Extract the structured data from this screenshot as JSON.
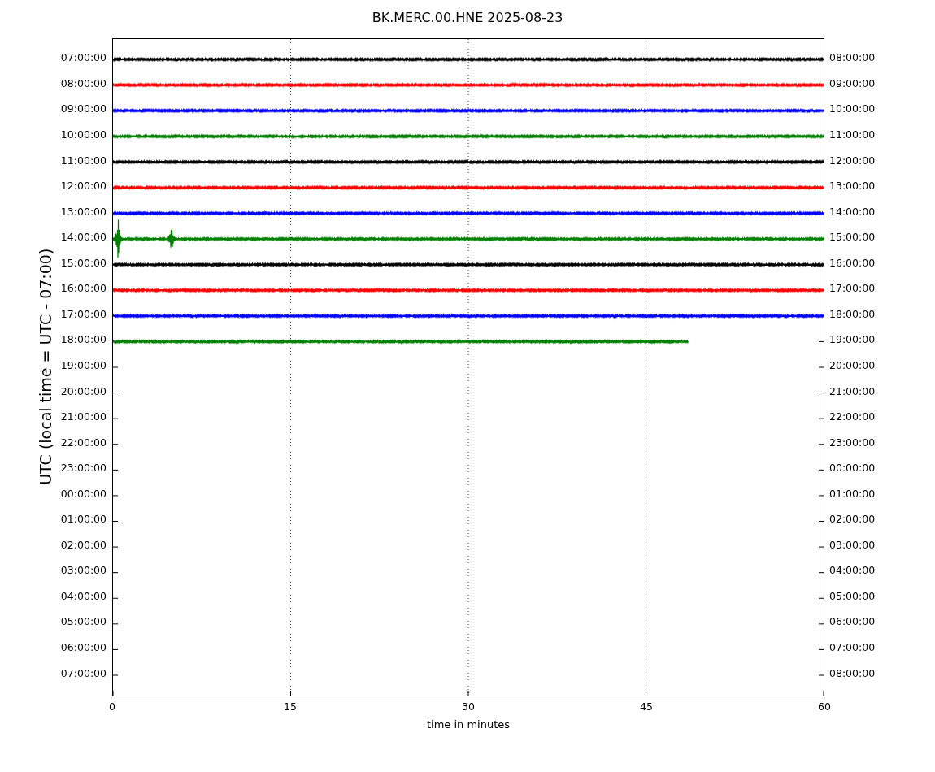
{
  "title": "BK.MERC.00.HNE 2025-08-23",
  "y_axis_label": "UTC (local time = UTC - 07:00)",
  "x_axis_label": "time in minutes",
  "x_ticks": [
    "0",
    "15",
    "30",
    "45",
    "60"
  ],
  "rows": [
    {
      "left": "07:00:00",
      "right": "08:00:00"
    },
    {
      "left": "08:00:00",
      "right": "09:00:00"
    },
    {
      "left": "09:00:00",
      "right": "10:00:00"
    },
    {
      "left": "10:00:00",
      "right": "11:00:00"
    },
    {
      "left": "11:00:00",
      "right": "12:00:00"
    },
    {
      "left": "12:00:00",
      "right": "13:00:00"
    },
    {
      "left": "13:00:00",
      "right": "14:00:00"
    },
    {
      "left": "14:00:00",
      "right": "15:00:00"
    },
    {
      "left": "15:00:00",
      "right": "16:00:00"
    },
    {
      "left": "16:00:00",
      "right": "17:00:00"
    },
    {
      "left": "17:00:00",
      "right": "18:00:00"
    },
    {
      "left": "18:00:00",
      "right": "19:00:00"
    },
    {
      "left": "19:00:00",
      "right": "20:00:00"
    },
    {
      "left": "20:00:00",
      "right": "21:00:00"
    },
    {
      "left": "21:00:00",
      "right": "22:00:00"
    },
    {
      "left": "22:00:00",
      "right": "23:00:00"
    },
    {
      "left": "23:00:00",
      "right": "00:00:00"
    },
    {
      "left": "00:00:00",
      "right": "01:00:00"
    },
    {
      "left": "01:00:00",
      "right": "02:00:00"
    },
    {
      "left": "02:00:00",
      "right": "03:00:00"
    },
    {
      "left": "03:00:00",
      "right": "04:00:00"
    },
    {
      "left": "04:00:00",
      "right": "05:00:00"
    },
    {
      "left": "05:00:00",
      "right": "06:00:00"
    },
    {
      "left": "06:00:00",
      "right": "07:00:00"
    },
    {
      "left": "07:00:00",
      "right": "08:00:00"
    }
  ],
  "traces": [
    {
      "color": "#000000",
      "level": 1,
      "kind": "quiet"
    },
    {
      "color": "#ff0000",
      "level": 1,
      "kind": "quiet"
    },
    {
      "color": "#0000ff",
      "level": 1,
      "kind": "quiet"
    },
    {
      "color": "#008000",
      "level": 1,
      "kind": "quiet"
    },
    {
      "color": "#000000",
      "level": 1,
      "kind": "quiet"
    },
    {
      "color": "#ff0000",
      "level": 1,
      "kind": "quiet"
    },
    {
      "color": "#0000ff",
      "level": 1,
      "kind": "quiet"
    },
    {
      "color": "#008000",
      "level": 1,
      "kind": "spiky"
    },
    {
      "color": "#000000",
      "level": 1,
      "kind": "quiet"
    },
    {
      "color": "#ff0000",
      "level": 1,
      "kind": "quiet"
    },
    {
      "color": "#0000ff",
      "level": 1,
      "kind": "quiet"
    },
    {
      "color": "#008000",
      "level": 0.81,
      "kind": "quiet"
    }
  ]
}
